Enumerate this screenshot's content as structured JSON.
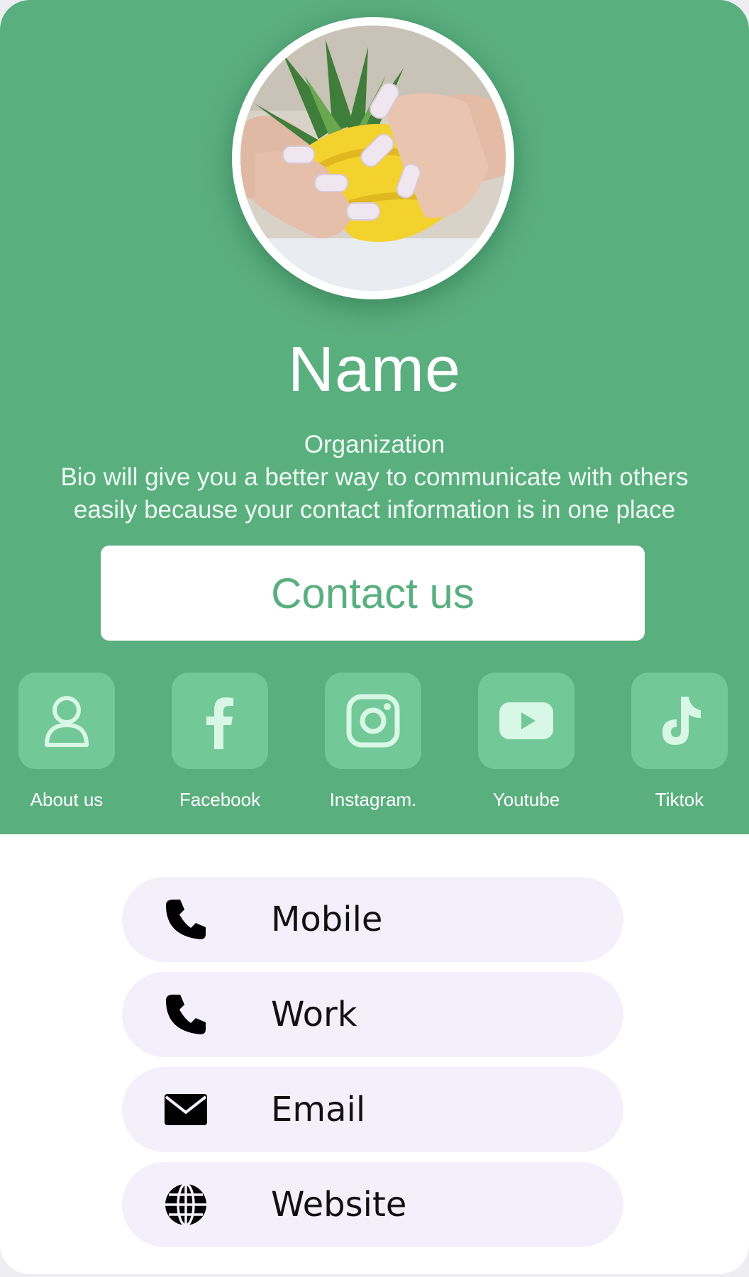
{
  "profile": {
    "name": "Name",
    "organization": "Organization",
    "bio": "Bio will give you a better way to communicate with others easily because your contact information is in one place",
    "avatar_icon": "profile-photo"
  },
  "contact_button": {
    "label": "Contact us"
  },
  "socials": [
    {
      "label": "About us",
      "icon": "person-icon"
    },
    {
      "label": "Facebook",
      "icon": "facebook-icon"
    },
    {
      "label": "Instagram.",
      "icon": "instagram-icon"
    },
    {
      "label": "Youtube",
      "icon": "youtube-icon"
    },
    {
      "label": "Tiktok",
      "icon": "tiktok-icon"
    }
  ],
  "contacts": [
    {
      "label": "Mobile",
      "icon": "phone-icon"
    },
    {
      "label": "Work",
      "icon": "phone-icon"
    },
    {
      "label": "Email",
      "icon": "envelope-icon"
    },
    {
      "label": "Website",
      "icon": "globe-icon"
    }
  ],
  "colors": {
    "brand_green": "#5aaf7f",
    "tile_green": "#72c896",
    "icon_mint": "#d9f7e6",
    "pill_background": "#f3f0fb"
  }
}
